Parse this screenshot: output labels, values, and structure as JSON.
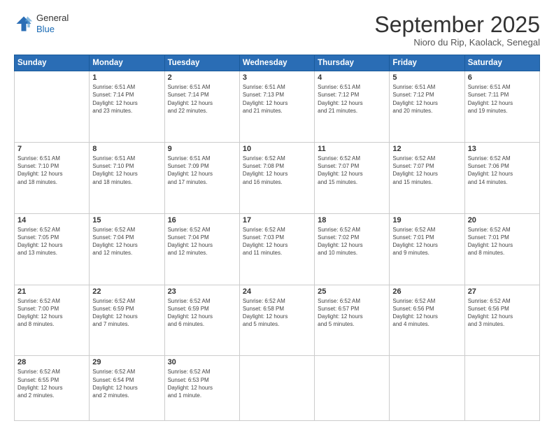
{
  "header": {
    "logo": {
      "line1": "General",
      "line2": "Blue"
    },
    "title": "September 2025",
    "subtitle": "Nioro du Rip, Kaolack, Senegal"
  },
  "weekdays": [
    "Sunday",
    "Monday",
    "Tuesday",
    "Wednesday",
    "Thursday",
    "Friday",
    "Saturday"
  ],
  "weeks": [
    [
      {
        "day": "",
        "info": ""
      },
      {
        "day": "1",
        "info": "Sunrise: 6:51 AM\nSunset: 7:14 PM\nDaylight: 12 hours\nand 23 minutes."
      },
      {
        "day": "2",
        "info": "Sunrise: 6:51 AM\nSunset: 7:14 PM\nDaylight: 12 hours\nand 22 minutes."
      },
      {
        "day": "3",
        "info": "Sunrise: 6:51 AM\nSunset: 7:13 PM\nDaylight: 12 hours\nand 21 minutes."
      },
      {
        "day": "4",
        "info": "Sunrise: 6:51 AM\nSunset: 7:12 PM\nDaylight: 12 hours\nand 21 minutes."
      },
      {
        "day": "5",
        "info": "Sunrise: 6:51 AM\nSunset: 7:12 PM\nDaylight: 12 hours\nand 20 minutes."
      },
      {
        "day": "6",
        "info": "Sunrise: 6:51 AM\nSunset: 7:11 PM\nDaylight: 12 hours\nand 19 minutes."
      }
    ],
    [
      {
        "day": "7",
        "info": "Sunrise: 6:51 AM\nSunset: 7:10 PM\nDaylight: 12 hours\nand 18 minutes."
      },
      {
        "day": "8",
        "info": "Sunrise: 6:51 AM\nSunset: 7:10 PM\nDaylight: 12 hours\nand 18 minutes."
      },
      {
        "day": "9",
        "info": "Sunrise: 6:51 AM\nSunset: 7:09 PM\nDaylight: 12 hours\nand 17 minutes."
      },
      {
        "day": "10",
        "info": "Sunrise: 6:52 AM\nSunset: 7:08 PM\nDaylight: 12 hours\nand 16 minutes."
      },
      {
        "day": "11",
        "info": "Sunrise: 6:52 AM\nSunset: 7:07 PM\nDaylight: 12 hours\nand 15 minutes."
      },
      {
        "day": "12",
        "info": "Sunrise: 6:52 AM\nSunset: 7:07 PM\nDaylight: 12 hours\nand 15 minutes."
      },
      {
        "day": "13",
        "info": "Sunrise: 6:52 AM\nSunset: 7:06 PM\nDaylight: 12 hours\nand 14 minutes."
      }
    ],
    [
      {
        "day": "14",
        "info": "Sunrise: 6:52 AM\nSunset: 7:05 PM\nDaylight: 12 hours\nand 13 minutes."
      },
      {
        "day": "15",
        "info": "Sunrise: 6:52 AM\nSunset: 7:04 PM\nDaylight: 12 hours\nand 12 minutes."
      },
      {
        "day": "16",
        "info": "Sunrise: 6:52 AM\nSunset: 7:04 PM\nDaylight: 12 hours\nand 12 minutes."
      },
      {
        "day": "17",
        "info": "Sunrise: 6:52 AM\nSunset: 7:03 PM\nDaylight: 12 hours\nand 11 minutes."
      },
      {
        "day": "18",
        "info": "Sunrise: 6:52 AM\nSunset: 7:02 PM\nDaylight: 12 hours\nand 10 minutes."
      },
      {
        "day": "19",
        "info": "Sunrise: 6:52 AM\nSunset: 7:01 PM\nDaylight: 12 hours\nand 9 minutes."
      },
      {
        "day": "20",
        "info": "Sunrise: 6:52 AM\nSunset: 7:01 PM\nDaylight: 12 hours\nand 8 minutes."
      }
    ],
    [
      {
        "day": "21",
        "info": "Sunrise: 6:52 AM\nSunset: 7:00 PM\nDaylight: 12 hours\nand 8 minutes."
      },
      {
        "day": "22",
        "info": "Sunrise: 6:52 AM\nSunset: 6:59 PM\nDaylight: 12 hours\nand 7 minutes."
      },
      {
        "day": "23",
        "info": "Sunrise: 6:52 AM\nSunset: 6:59 PM\nDaylight: 12 hours\nand 6 minutes."
      },
      {
        "day": "24",
        "info": "Sunrise: 6:52 AM\nSunset: 6:58 PM\nDaylight: 12 hours\nand 5 minutes."
      },
      {
        "day": "25",
        "info": "Sunrise: 6:52 AM\nSunset: 6:57 PM\nDaylight: 12 hours\nand 5 minutes."
      },
      {
        "day": "26",
        "info": "Sunrise: 6:52 AM\nSunset: 6:56 PM\nDaylight: 12 hours\nand 4 minutes."
      },
      {
        "day": "27",
        "info": "Sunrise: 6:52 AM\nSunset: 6:56 PM\nDaylight: 12 hours\nand 3 minutes."
      }
    ],
    [
      {
        "day": "28",
        "info": "Sunrise: 6:52 AM\nSunset: 6:55 PM\nDaylight: 12 hours\nand 2 minutes."
      },
      {
        "day": "29",
        "info": "Sunrise: 6:52 AM\nSunset: 6:54 PM\nDaylight: 12 hours\nand 2 minutes."
      },
      {
        "day": "30",
        "info": "Sunrise: 6:52 AM\nSunset: 6:53 PM\nDaylight: 12 hours\nand 1 minute."
      },
      {
        "day": "",
        "info": ""
      },
      {
        "day": "",
        "info": ""
      },
      {
        "day": "",
        "info": ""
      },
      {
        "day": "",
        "info": ""
      }
    ]
  ]
}
